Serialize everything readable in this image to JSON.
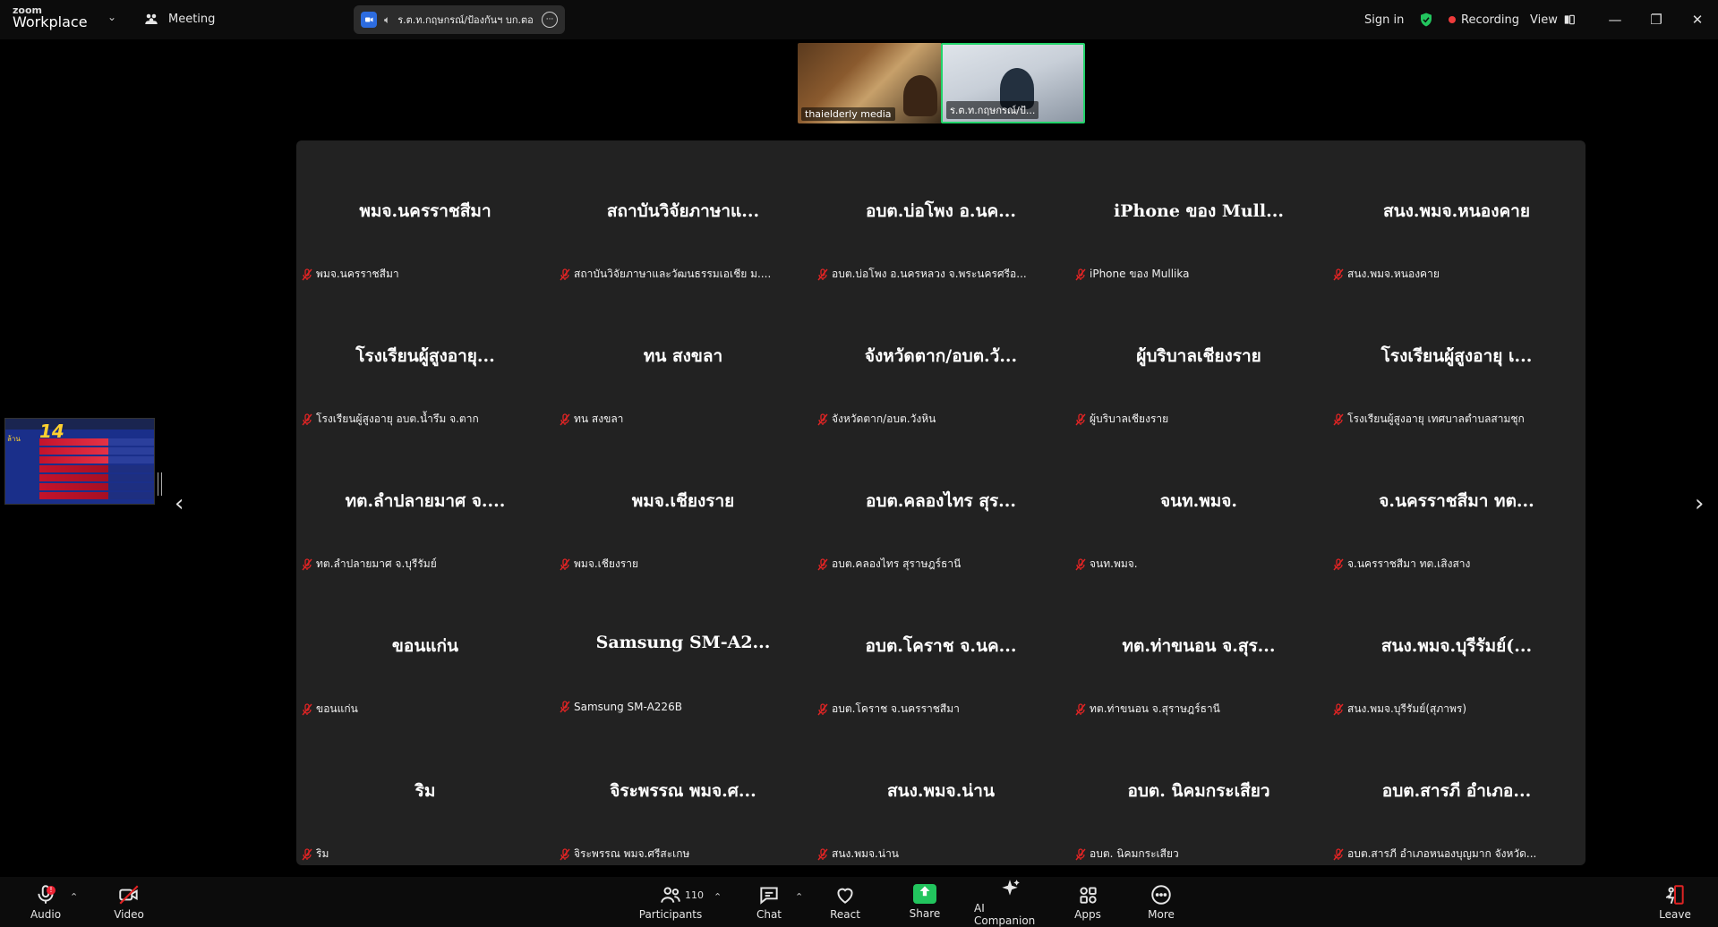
{
  "app": {
    "logo_top": "zoom",
    "logo_bottom": "Workplace"
  },
  "topbar": {
    "meeting_label": "Meeting",
    "topic": "ร.ต.ท.กฤษกรณ์/ป้องกันฯ บก.ตอ",
    "sign_in": "Sign in",
    "recording": "Recording",
    "view": "View"
  },
  "thumbnails": [
    {
      "name": "thaielderly media"
    },
    {
      "name": "ร.ต.ท.กฤษกรณ์/ป้..."
    }
  ],
  "grid": {
    "tiles": [
      {
        "display": "พมจ.นครราชสีมา",
        "label": "พมจ.นครราชสีมา"
      },
      {
        "display": "สถาบันวิจัยภาษาแ...",
        "label": "สถาบันวิจัยภาษาและวัฒนธรรมเอเชีย ม...."
      },
      {
        "display": "อบต.บ่อโพง อ.นค...",
        "label": "อบต.บ่อโพง อ.นครหลวง จ.พระนครศรีอ..."
      },
      {
        "display": "iPhone ของ Mull...",
        "label": "iPhone ของ Mullika"
      },
      {
        "display": "สนง.พมจ.หนองคาย",
        "label": "สนง.พมจ.หนองคาย"
      },
      {
        "display": "โรงเรียนผู้สูงอายุ...",
        "label": "โรงเรียนผู้สูงอายุ อบต.น้ำรึม จ.ตาก"
      },
      {
        "display": "ทน สงขลา",
        "label": "ทน สงขลา"
      },
      {
        "display": "จังหวัดตาก/อบต.วั...",
        "label": "จังหวัดตาก/อบต.วังหิน"
      },
      {
        "display": "ผู้บริบาลเชียงราย",
        "label": "ผู้บริบาลเชียงราย"
      },
      {
        "display": "โรงเรียนผู้สูงอายุ เ...",
        "label": "โรงเรียนผู้สูงอายุ เทศบาลตำบลสามชุก"
      },
      {
        "display": "ทต.ลำปลายมาศ จ....",
        "label": "ทต.ลำปลายมาศ จ.บุรีรัมย์"
      },
      {
        "display": "พมจ.เชียงราย",
        "label": "พมจ.เชียงราย"
      },
      {
        "display": "อบต.คลองไทร สุร...",
        "label": "อบต.คลองไทร สุราษฎร์ธานี"
      },
      {
        "display": "จนท.พมจ.",
        "label": "จนท.พมจ."
      },
      {
        "display": "จ.นครราชสีมา ทต...",
        "label": "จ.นครราชสีมา ทต.เสิงสาง"
      },
      {
        "display": "ขอนแก่น",
        "label": "ขอนแก่น"
      },
      {
        "display": "Samsung  SM-A2...",
        "label": "Samsung SM-A226B"
      },
      {
        "display": "อบต.โคราช จ.นค...",
        "label": "อบต.โคราช จ.นครราชสีมา"
      },
      {
        "display": "ทต.ท่าขนอน จ.สุร...",
        "label": "ทต.ท่าขนอน จ.สุราษฎร์ธานี"
      },
      {
        "display": "สนง.พมจ.บุรีรัมย์(...",
        "label": "สนง.พมจ.บุรีรัมย์(สุภาพร)"
      },
      {
        "display": "ริม",
        "label": "ริม"
      },
      {
        "display": "จิระพรรณ พมจ.ศ...",
        "label": "จิระพรรณ พมจ.ศรีสะเกษ"
      },
      {
        "display": "สนง.พมจ.น่าน",
        "label": "สนง.พมจ.น่าน"
      },
      {
        "display": "อบต. นิคมกระเสียว",
        "label": "อบต. นิคมกระเสียว"
      },
      {
        "display": "อบต.สารภี อำเภอ...",
        "label": "อบต.สารภี อำเภอหนองบุญมาก จังหวัด..."
      }
    ]
  },
  "shared_screen": {
    "big": "14",
    "sub": "ล้าน"
  },
  "toolbar": {
    "audio": "Audio",
    "audio_alert": "!",
    "video": "Video",
    "participants": "Participants",
    "participant_count": "110",
    "chat": "Chat",
    "react": "React",
    "share": "Share",
    "ai_companion": "AI Companion",
    "apps": "Apps",
    "more": "More",
    "leave": "Leave"
  },
  "colors": {
    "accent_green": "#22c55e",
    "recording_red": "#ee3b3b",
    "mute_red": "#e02424",
    "grid_bg": "#222222"
  }
}
